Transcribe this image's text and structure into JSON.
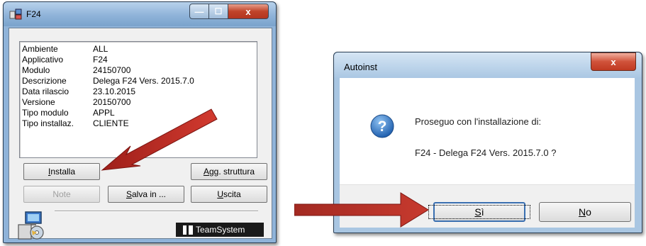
{
  "left_window": {
    "title": "F24",
    "controls": {
      "minimize": "—",
      "maximize": "☐",
      "close": "x"
    },
    "info": [
      {
        "key": "Ambiente",
        "value": "ALL"
      },
      {
        "key": "Applicativo",
        "value": "F24"
      },
      {
        "key": "Modulo",
        "value": "24150700"
      },
      {
        "key": "Descrizione",
        "value": "Delega F24 Vers. 2015.7.0"
      },
      {
        "key": "Data rilascio",
        "value": "23.10.2015"
      },
      {
        "key": "Versione",
        "value": "20150700"
      },
      {
        "key": "Tipo modulo",
        "value": "APPL"
      },
      {
        "key": "Tipo installaz.",
        "value": "CLIENTE"
      }
    ],
    "buttons": {
      "installa": {
        "mnemonic": "I",
        "rest": "nstalla"
      },
      "agg_struttura": {
        "mnemonic": "A",
        "rest": "gg. struttura"
      },
      "note": "Note",
      "salva_in": {
        "mnemonic": "S",
        "rest": "alva in ..."
      },
      "uscita": {
        "mnemonic": "U",
        "rest": "scita"
      }
    },
    "logo_text": "TeamSystem"
  },
  "right_dialog": {
    "title": "Autoinst",
    "close_label": "x",
    "message_line1": "Proseguo con l'installazione di:",
    "message_line2": "F24 - Delega F24 Vers. 2015.7.0 ?",
    "buttons": {
      "si": {
        "mnemonic": "S",
        "rest": "ì"
      },
      "no": {
        "mnemonic": "N",
        "rest": "o"
      }
    }
  },
  "colors": {
    "annotation_arrow": "#c0302a",
    "accent_blue": "#3a6fb0"
  },
  "icons": [
    "app-icon",
    "setup-icon",
    "question-icon",
    "teamsystem-logo-icon"
  ]
}
